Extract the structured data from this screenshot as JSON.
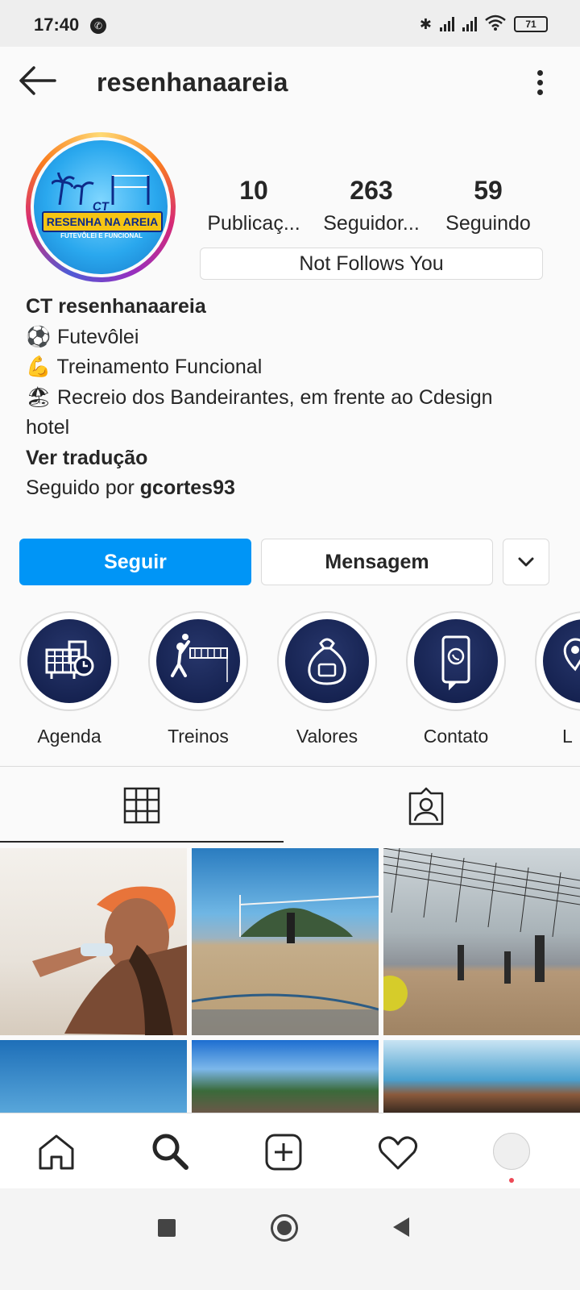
{
  "status_bar": {
    "time": "17:40",
    "battery": "71"
  },
  "header": {
    "username": "resenhanaareia"
  },
  "avatar": {
    "logo_top": "CT",
    "logo_main": "RESENHA NA AREIA",
    "logo_sub": "FUTEVÔLEI E FUNCIONAL"
  },
  "stats": [
    {
      "value": "10",
      "label": "Publicaç..."
    },
    {
      "value": "263",
      "label": "Seguidor..."
    },
    {
      "value": "59",
      "label": "Seguindo"
    }
  ],
  "follows_status": "Not Follows You",
  "bio": {
    "name": "CT resenhanaareia",
    "lines": [
      {
        "emoji": "⚽",
        "text": "Futevôlei"
      },
      {
        "emoji": "💪",
        "text": "Treinamento Funcional"
      },
      {
        "emoji": "🏖",
        "text": "Recreio dos Bandeirantes, em frente ao Cdesign"
      }
    ],
    "line_cont": "hotel",
    "translate": "Ver tradução",
    "followed_by_prefix": "Seguido por ",
    "followed_by_user": "gcortes93"
  },
  "buttons": {
    "follow": "Seguir",
    "message": "Mensagem"
  },
  "highlights": [
    {
      "label": "Agenda",
      "icon": "calendar-building-icon"
    },
    {
      "label": "Treinos",
      "icon": "volleyball-player-icon"
    },
    {
      "label": "Valores",
      "icon": "money-bag-icon"
    },
    {
      "label": "Contato",
      "icon": "phone-whatsapp-icon"
    },
    {
      "label": "L",
      "icon": "location-pin-icon"
    }
  ],
  "tabs": [
    {
      "icon": "grid-icon",
      "active": true
    },
    {
      "icon": "tagged-person-icon",
      "active": false
    }
  ],
  "nav": [
    "home-icon",
    "search-icon",
    "new-post-icon",
    "activity-heart-icon",
    "profile-avatar-icon"
  ],
  "colors": {
    "primary_button": "#0095f6",
    "highlight_bg": "#1a2757",
    "notification_dot": "#ed4956"
  }
}
